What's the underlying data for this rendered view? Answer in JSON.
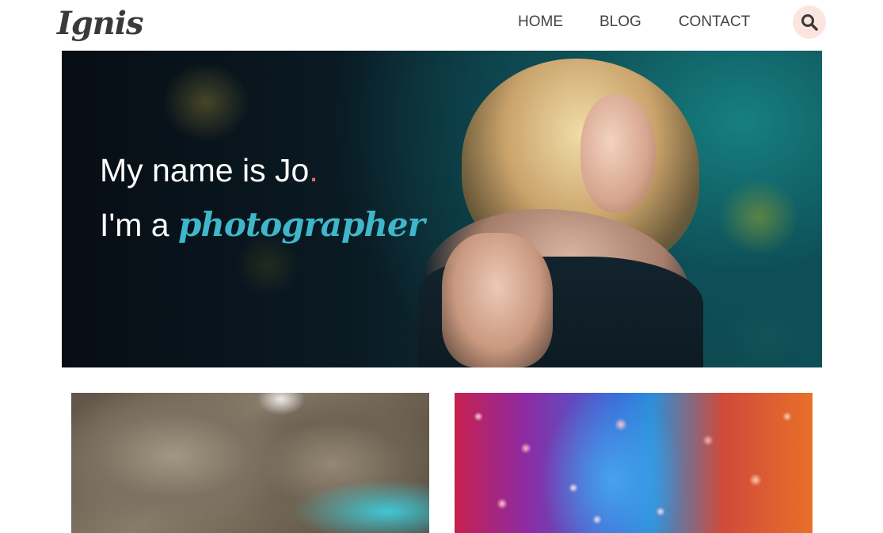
{
  "brand": {
    "logo_text": "Ignis"
  },
  "nav": {
    "items": [
      {
        "label": "HOME"
      },
      {
        "label": "BLOG"
      },
      {
        "label": "CONTACT"
      }
    ]
  },
  "search": {
    "icon": "search-icon"
  },
  "hero": {
    "line1": "My name is Jo",
    "line1_dot": ".",
    "line2_prefix": "I'm a ",
    "line2_role": "photographer"
  },
  "colors": {
    "accent_dot": "#f06b6b",
    "role_color": "#3fb6c9",
    "search_bg": "#fbe6df"
  }
}
